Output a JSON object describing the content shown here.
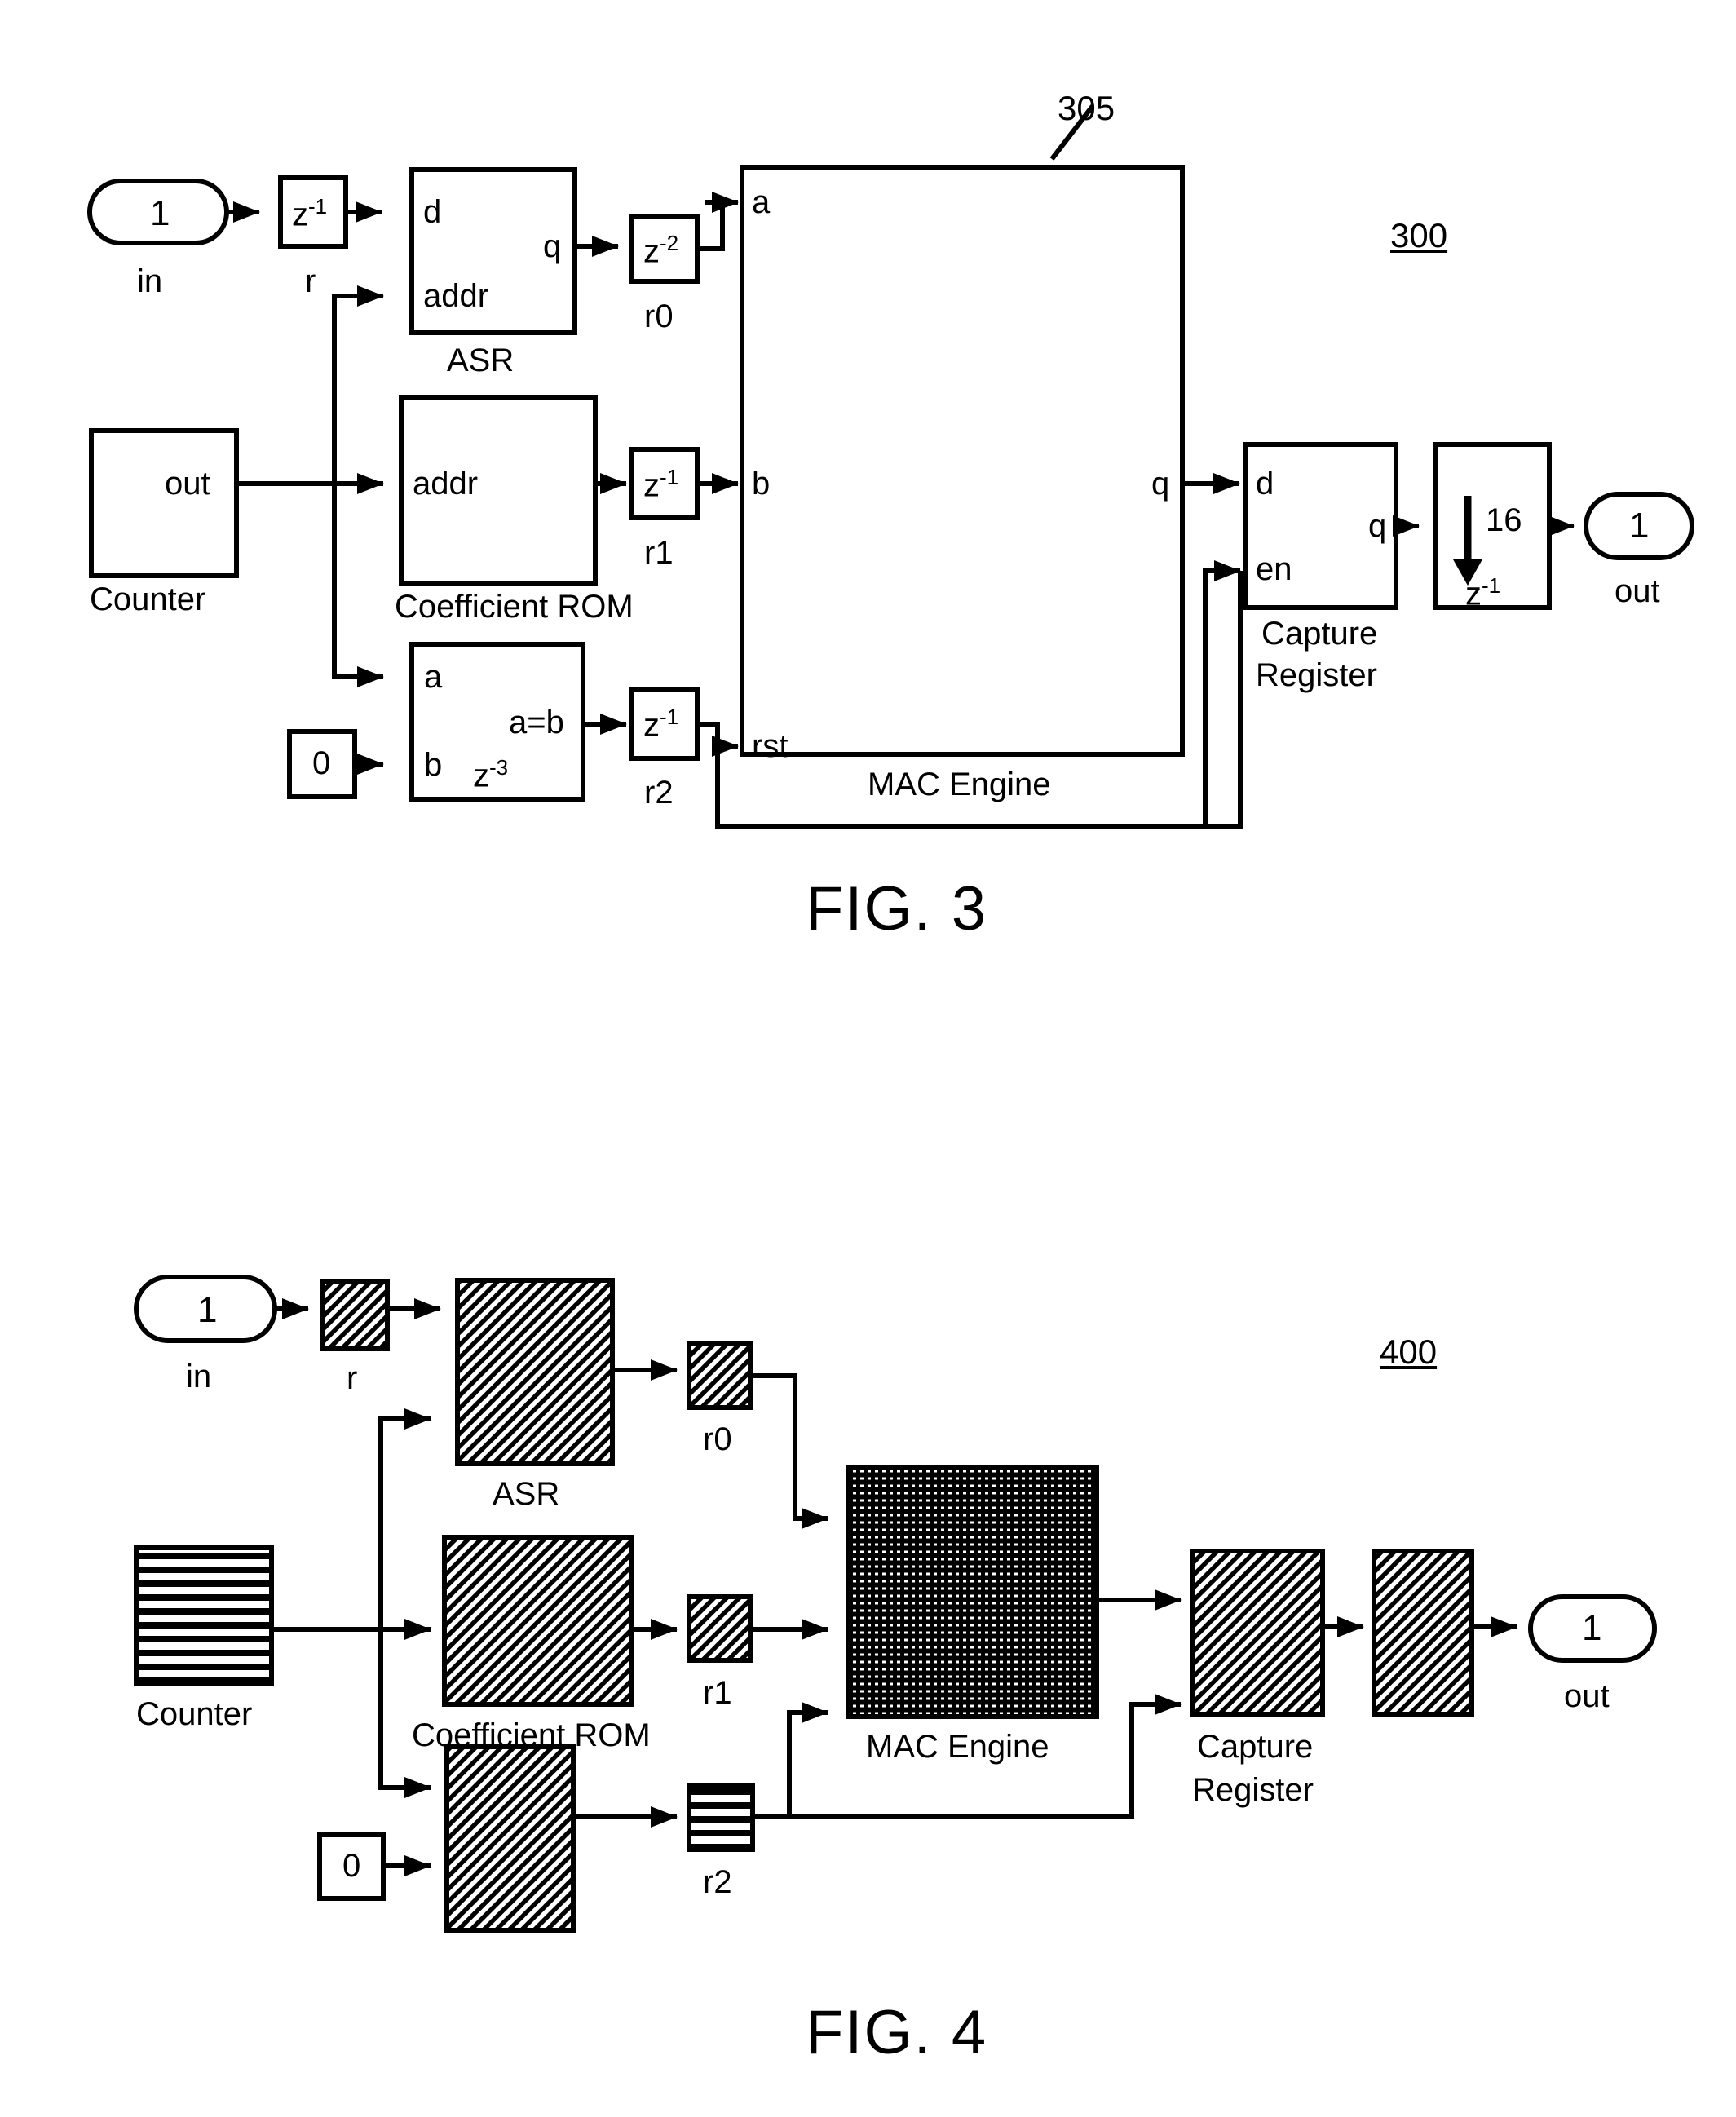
{
  "figures": [
    {
      "id": "fig3",
      "caption": "FIG. 3",
      "ref_label": "300",
      "callout_label": "305",
      "nodes": {
        "in_port": {
          "number": "1",
          "label": "in"
        },
        "reg_r": {
          "symbol_base": "z",
          "symbol_exp": "-1",
          "label": "r"
        },
        "asr": {
          "label": "ASR",
          "port_d": "d",
          "port_addr": "addr",
          "port_q": "q"
        },
        "reg_r0": {
          "symbol_base": "z",
          "symbol_exp": "-2",
          "label": "r0"
        },
        "counter": {
          "label": "Counter",
          "port_out": "out"
        },
        "coefficient_rom": {
          "label": "Coefficient ROM",
          "port_addr": "addr"
        },
        "reg_r1": {
          "symbol_base": "z",
          "symbol_exp": "-1",
          "label": "r1"
        },
        "comparator": {
          "port_a": "a",
          "port_b": "b",
          "port_out": "a=b",
          "delay_base": "z",
          "delay_exp": "-3"
        },
        "const_zero": {
          "value": "0"
        },
        "reg_r2": {
          "symbol_base": "z",
          "symbol_exp": "-1",
          "label": "r2"
        },
        "mac_engine": {
          "label": "MAC Engine",
          "port_a": "a",
          "port_b": "b",
          "port_rst": "rst",
          "port_q": "q"
        },
        "capture_register": {
          "label_line1": "Capture",
          "label_line2": "Register",
          "port_d": "d",
          "port_en": "en",
          "port_q": "q"
        },
        "downsample": {
          "factor": "16",
          "symbol_base": "z",
          "symbol_exp": "-1"
        },
        "out_port": {
          "number": "1",
          "label": "out"
        }
      }
    },
    {
      "id": "fig4",
      "caption": "FIG. 4",
      "ref_label": "400",
      "nodes": {
        "in_port": {
          "number": "1",
          "label": "in"
        },
        "reg_r": {
          "label": "r",
          "fill": "diag-hatch"
        },
        "asr": {
          "label": "ASR",
          "fill": "diag-hatch"
        },
        "reg_r0": {
          "label": "r0",
          "fill": "diag-hatch"
        },
        "counter": {
          "label": "Counter",
          "fill": "horiz-stripe"
        },
        "coefficient_rom": {
          "label": "Coefficient ROM",
          "fill": "diag-hatch"
        },
        "reg_r1": {
          "label": "r1",
          "fill": "diag-hatch"
        },
        "comparator": {
          "label": "",
          "fill": "diag-hatch"
        },
        "const_zero": {
          "value": "0"
        },
        "reg_r2": {
          "label": "r2",
          "fill": "horiz-stripe"
        },
        "mac_engine": {
          "label": "MAC Engine",
          "fill": "dense-cross"
        },
        "capture_register": {
          "label_line1": "Capture",
          "label_line2": "Register",
          "fill": "diag-hatch"
        },
        "downsample": {
          "label": "",
          "fill": "diag-hatch"
        },
        "out_port": {
          "number": "1",
          "label": "out"
        }
      }
    }
  ]
}
